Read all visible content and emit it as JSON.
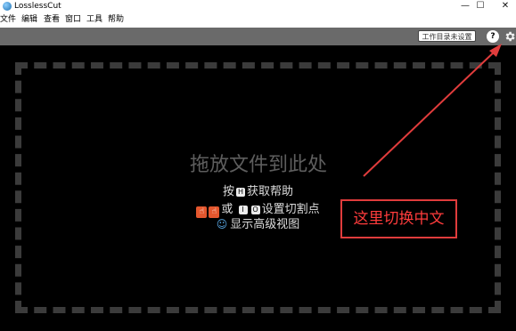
{
  "window": {
    "title": "LosslessCut",
    "minimize_glyph": "—",
    "maximize_glyph": "☐",
    "close_glyph": "✕"
  },
  "menu": {
    "items": [
      "文件",
      "编辑",
      "查看",
      "窗口",
      "工具",
      "帮助"
    ]
  },
  "toolbar": {
    "workdir_label": "工作目录未设置",
    "help_label": "?",
    "settings_icon": "gear-icon"
  },
  "dropzone": {
    "title": "拖放文件到此处",
    "help_prefix": "按",
    "help_key": "H",
    "help_suffix": "获取帮助",
    "cut_or": "或",
    "cut_key_in": "I",
    "cut_key_out": "O",
    "cut_suffix": "设置切割点",
    "advanced_label": "显示高级视图"
  },
  "annotation": {
    "text": "这里切换中文",
    "color": "#e03c3c"
  }
}
